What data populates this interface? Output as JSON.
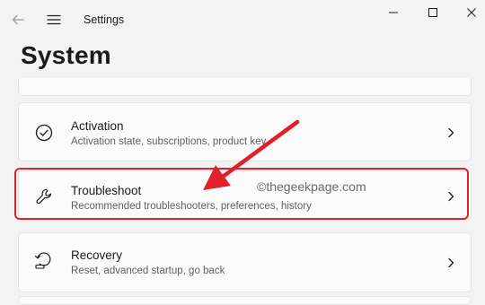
{
  "window": {
    "title": "Settings"
  },
  "page": {
    "title": "System"
  },
  "items": [
    {
      "title": "Activation",
      "subtitle": "Activation state, subscriptions, product key",
      "icon": "check-circle-icon"
    },
    {
      "title": "Troubleshoot",
      "subtitle": "Recommended troubleshooters, preferences, history",
      "icon": "wrench-icon",
      "highlighted": true
    },
    {
      "title": "Recovery",
      "subtitle": "Reset, advanced startup, go back",
      "icon": "recovery-icon"
    }
  ],
  "watermark": "©thegeekpage.com",
  "colors": {
    "background": "#f3f3f3",
    "card": "#fbfbfb",
    "highlight": "#e0202a",
    "annotation_arrow": "#e0202a"
  }
}
